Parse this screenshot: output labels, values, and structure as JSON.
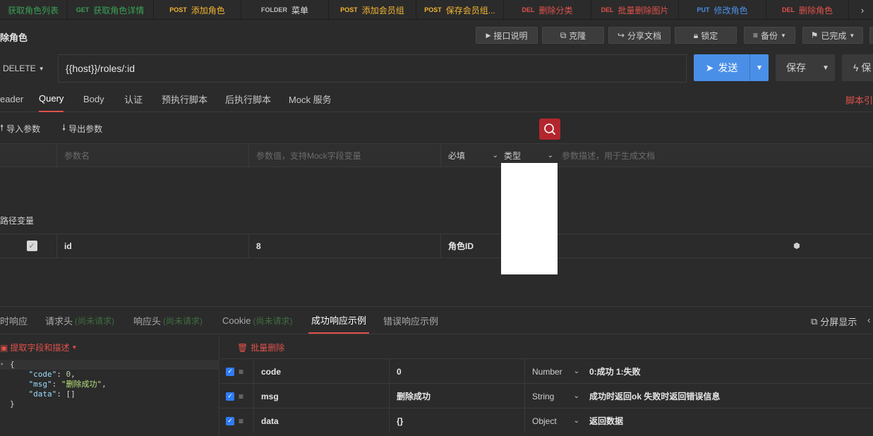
{
  "tabs": [
    {
      "method": "",
      "label": "获取角色列表",
      "method_color": "#3aa055",
      "label_color": "#3aa055",
      "width": 95
    },
    {
      "method": "GET",
      "label": "获取角色详情",
      "method_color": "#3aa055",
      "label_color": "#3aa055",
      "width": 123
    },
    {
      "method": "POST",
      "label": "添加角色",
      "method_color": "#f2b531",
      "label_color": "#f2b531",
      "width": 124
    },
    {
      "method": "FOLDER",
      "label": "菜单",
      "method_color": "#bdbdbd",
      "label_color": "#e0e0e0",
      "width": 124
    },
    {
      "method": "POST",
      "label": "添加会员组",
      "method_color": "#f2b531",
      "label_color": "#f2b531",
      "width": 124
    },
    {
      "method": "POST",
      "label": "保存会员组...",
      "method_color": "#f2b531",
      "label_color": "#f2b531",
      "width": 124
    },
    {
      "method": "DEL",
      "label": "删除分类",
      "method_color": "#e0514b",
      "label_color": "#e0514b",
      "width": 124
    },
    {
      "method": "DEL",
      "label": "批量删除图片",
      "method_color": "#e0514b",
      "label_color": "#e0514b",
      "width": 124
    },
    {
      "method": "PUT",
      "label": "修改角色",
      "method_color": "#4a8fe7",
      "label_color": "#4a8fe7",
      "width": 124
    },
    {
      "method": "DEL",
      "label": "删除角色",
      "method_color": "#e0514b",
      "label_color": "#e0514b",
      "width": 117
    }
  ],
  "title": "除角色",
  "toolbar": {
    "doc": "接口说明",
    "clone": "克隆",
    "share": "分享文档",
    "lock": "锁定",
    "backup": "备份",
    "done": "已完成"
  },
  "request": {
    "method": "DELETE",
    "url": "{{host}}/roles/:id",
    "send": "发送",
    "save": "保存",
    "save2": "保"
  },
  "request_tabs": [
    "eader",
    "Query",
    "Body",
    "认证",
    "预执行脚本",
    "后执行脚本",
    "Mock 服务"
  ],
  "script_link": "脚本引",
  "import_params": "导入参数",
  "export_params": "导出参数",
  "param_header": {
    "name_placeholder": "参数名",
    "value_placeholder": "参数值，支持Mock字段变量",
    "required": "必填",
    "type": "类型",
    "desc_placeholder": "参数描述，用于生成文档"
  },
  "path_section": "路径变量",
  "path_param": {
    "name": "id",
    "value": "8",
    "desc": "角色ID"
  },
  "response_tabs": [
    {
      "label": "时响应",
      "sub": ""
    },
    {
      "label": "请求头",
      "sub": "(尚未请求)"
    },
    {
      "label": "响应头",
      "sub": "(尚未请求)"
    },
    {
      "label": "Cookie",
      "sub": "(尚未请求)"
    },
    {
      "label": "成功响应示例",
      "sub": ""
    },
    {
      "label": "错误响应示例",
      "sub": ""
    }
  ],
  "split_display": "分屏显示",
  "extract_label": "提取字段和描述",
  "batch_delete": "批量删除",
  "code_lines": [
    "{",
    "    \"code\": 0,",
    "    \"msg\": \"删除成功\",",
    "    \"data\": []",
    "}"
  ],
  "fields": [
    {
      "name": "code",
      "value": "0",
      "type": "Number",
      "desc": "0:成功 1:失败"
    },
    {
      "name": "msg",
      "value": "删除成功",
      "type": "String",
      "desc": "成功时返回ok 失败时返回错误信息"
    },
    {
      "name": "data",
      "value": "{}",
      "type": "Object",
      "desc": "返回数据"
    }
  ]
}
